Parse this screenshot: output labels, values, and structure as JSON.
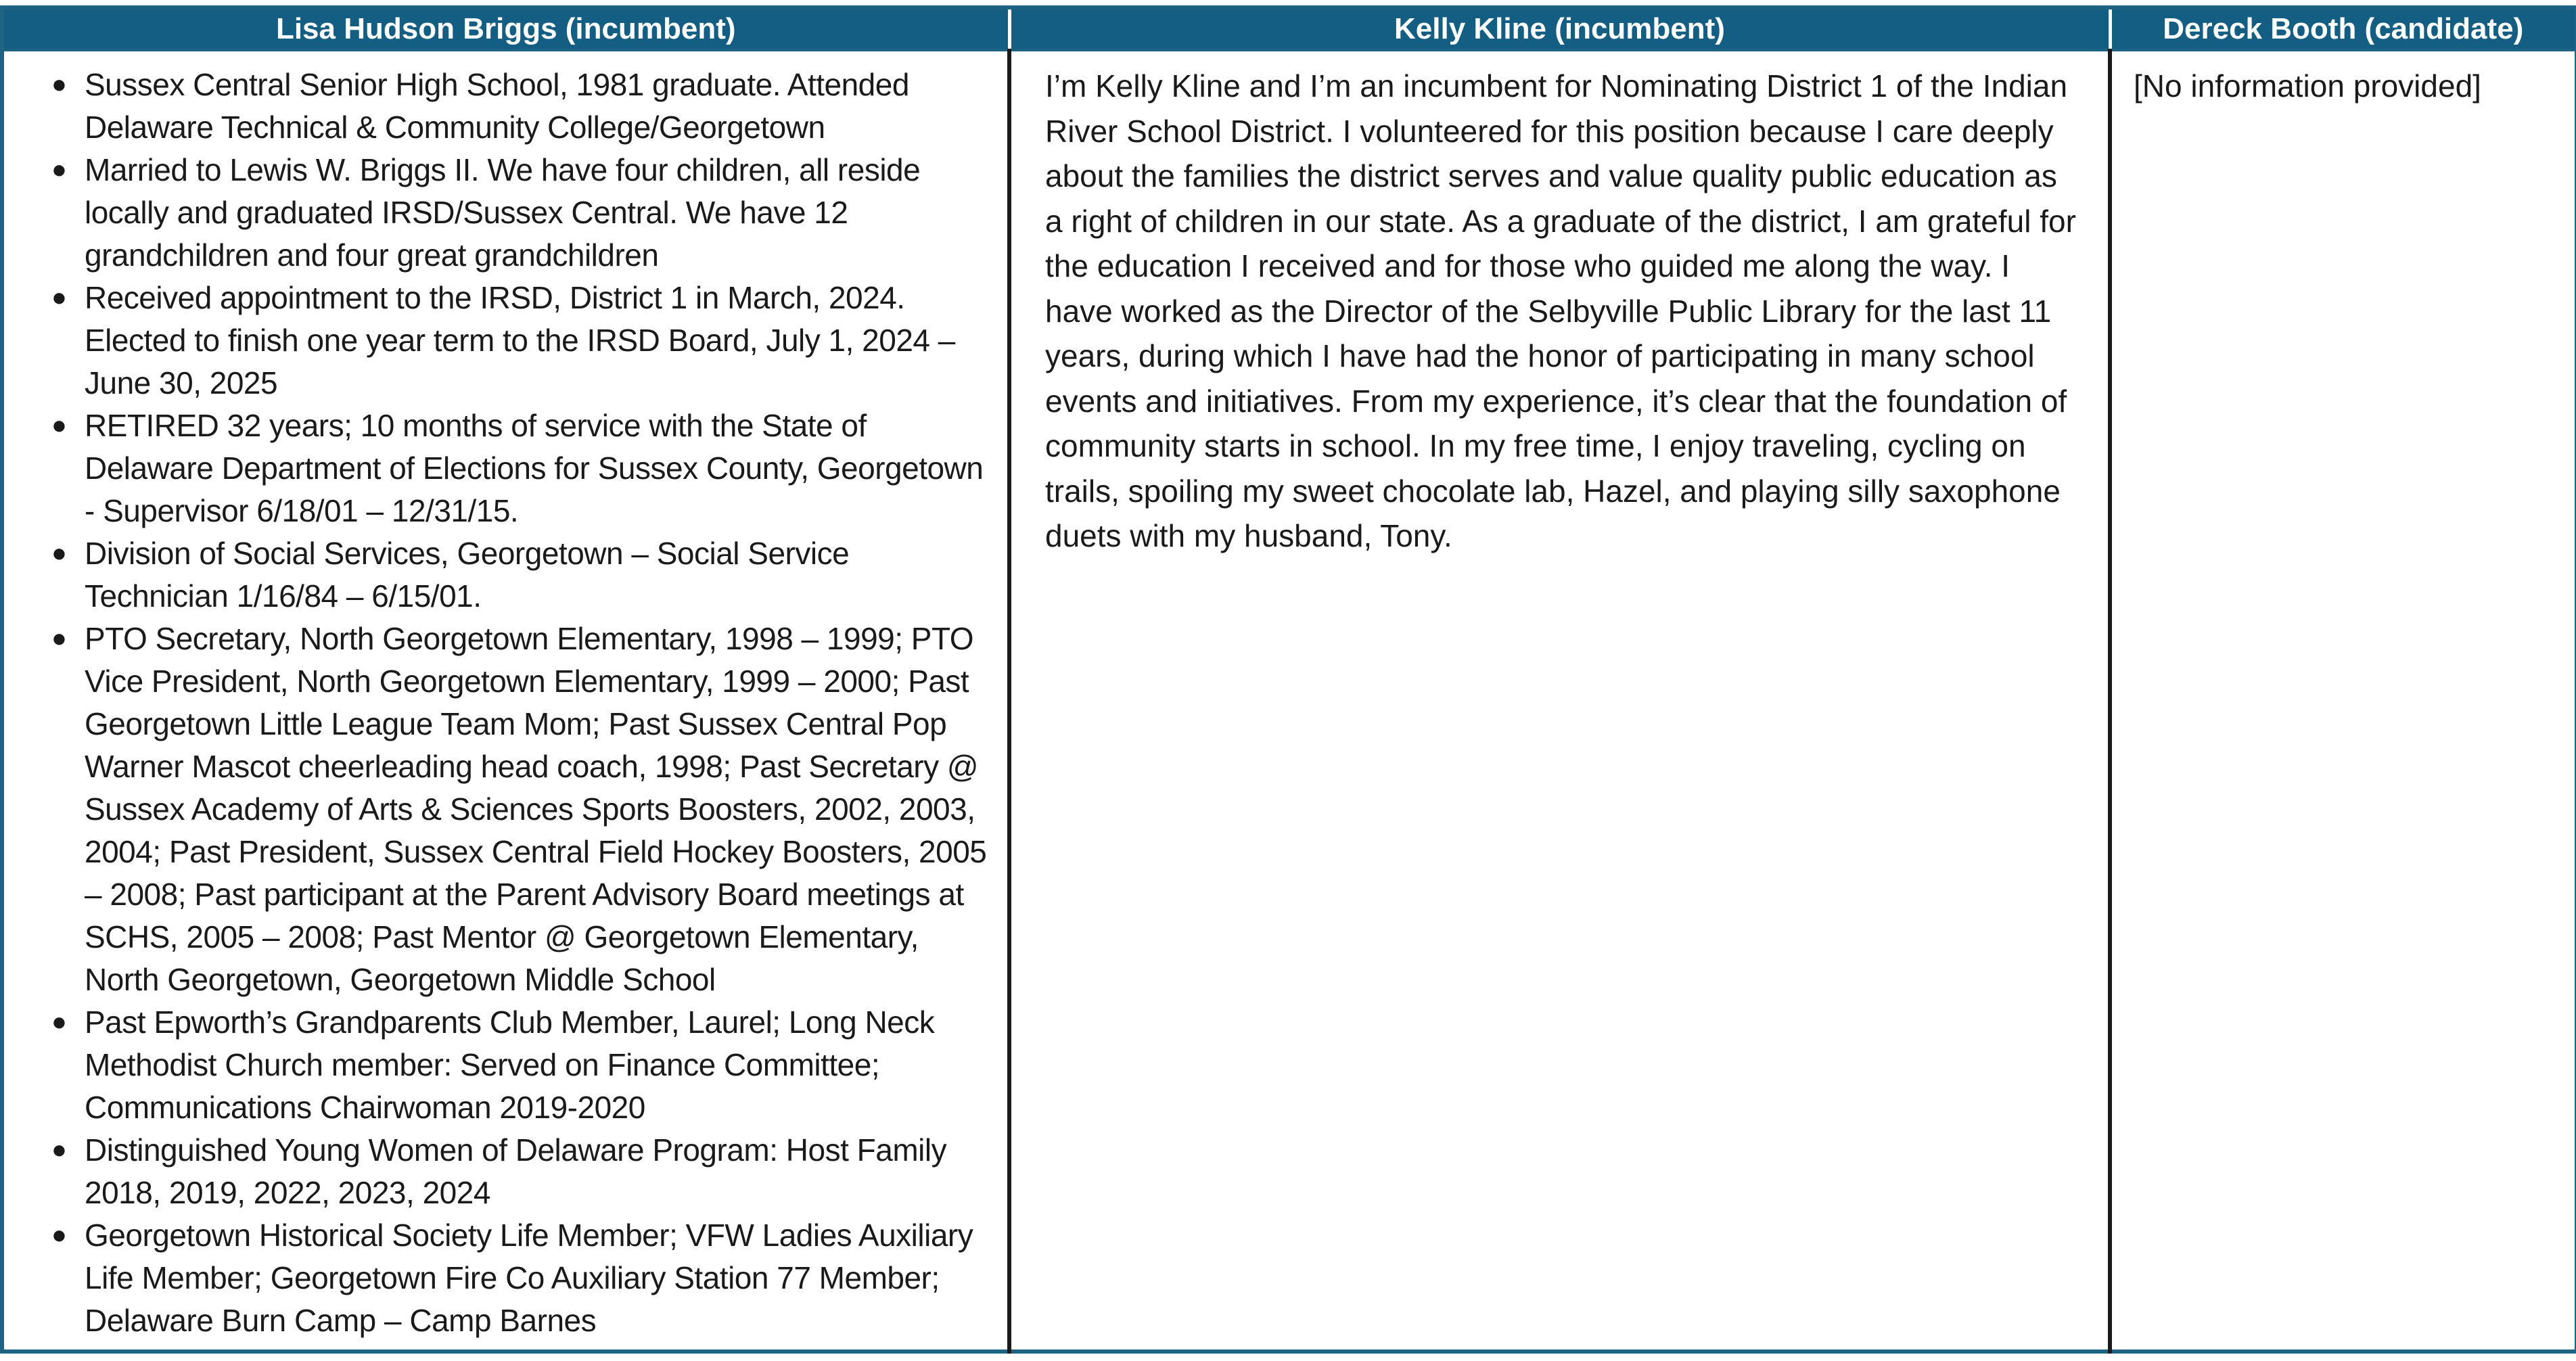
{
  "colors": {
    "header_background": "#145e84",
    "header_text": "#ffffff",
    "border": "#1f6384"
  },
  "headers": [
    "Lisa Hudson Briggs (incumbent)",
    "Kelly Kline (incumbent)",
    "Dereck Booth (candidate)"
  ],
  "briggs": {
    "items": [
      "Sussex Central Senior High School, 1981 graduate. Attended Delaware Technical & Community College/Georgetown",
      "Married to Lewis W. Briggs II. We have four children, all reside locally and graduated IRSD/Sussex Central. We have 12 grandchildren and four great grandchildren",
      "Received appointment to the IRSD, District 1 in March, 2024. Elected to finish one year term to the IRSD Board, July 1, 2024 – June 30, 2025",
      "RETIRED 32 years; 10 months of service with the State of Delaware  Department of Elections for Sussex County, Georgetown - Supervisor 6/18/01 – 12/31/15.",
      "Division of Social Services, Georgetown – Social Service Technician 1/16/84 – 6/15/01.",
      "PTO Secretary, North Georgetown Elementary, 1998 – 1999; PTO Vice President, North Georgetown Elementary, 1999 – 2000; Past Georgetown Little League Team Mom; Past Sussex Central Pop Warner Mascot cheerleading head coach, 1998; Past Secretary @ Sussex Academy of Arts & Sciences Sports Boosters, 2002, 2003, 2004; Past President, Sussex Central Field Hockey Boosters, 2005 – 2008; Past participant at the Parent Advisory Board meetings at SCHS, 2005 – 2008; Past Mentor @ Georgetown Elementary, North Georgetown, Georgetown Middle School",
      "Past Epworth’s Grandparents Club Member, Laurel; Long Neck Methodist Church member: Served on Finance Committee; Communications Chairwoman 2019-2020",
      "Distinguished Young Women of Delaware Program: Host Family 2018, 2019, 2022, 2023, 2024",
      "Georgetown Historical Society Life Member; VFW Ladies Auxiliary Life Member; Georgetown Fire Co Auxiliary Station 77 Member; Delaware Burn Camp – Camp Barnes"
    ]
  },
  "kline": {
    "bio": "I’m Kelly Kline and I’m an incumbent for Nominating District 1 of the Indian River School District. I volunteered for this position because I care deeply about the families the district serves and value quality public education as a right of children in our state. As a graduate of the district, I am grateful for the education I received and for those who guided me along the way. I have worked as the Director of the Selbyville Public Library for the last 11 years, during which I have had the honor of participating in many school events and initiatives. From my experience, it’s clear that the foundation of community starts in school. In my free time, I enjoy traveling, cycling on trails, spoiling my sweet chocolate lab, Hazel, and playing silly saxophone duets with my husband, Tony."
  },
  "booth": {
    "bio": "[No information provided]"
  }
}
